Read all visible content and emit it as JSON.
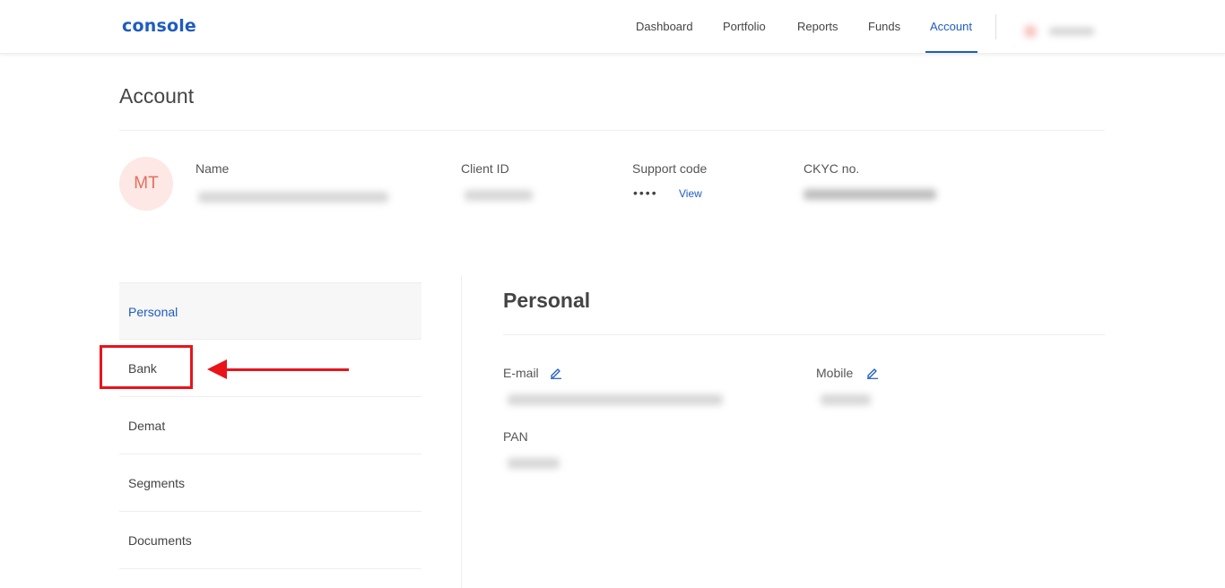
{
  "header": {
    "logo": "console",
    "nav": [
      {
        "label": "Dashboard",
        "active": false
      },
      {
        "label": "Portfolio",
        "active": false
      },
      {
        "label": "Reports",
        "active": false
      },
      {
        "label": "Funds",
        "active": false
      },
      {
        "label": "Account",
        "active": true
      }
    ]
  },
  "page": {
    "title": "Account"
  },
  "profile": {
    "initials": "MT",
    "name_label": "Name",
    "client_id_label": "Client ID",
    "support_code_label": "Support code",
    "support_code_mask": "••••",
    "support_view_label": "View",
    "ckyc_label": "CKYC no."
  },
  "sidebar": {
    "items": [
      {
        "label": "Personal",
        "active": true
      },
      {
        "label": "Bank",
        "active": false
      },
      {
        "label": "Demat",
        "active": false
      },
      {
        "label": "Segments",
        "active": false
      },
      {
        "label": "Documents",
        "active": false
      }
    ]
  },
  "personal": {
    "title": "Personal",
    "email_label": "E-mail",
    "mobile_label": "Mobile",
    "pan_label": "PAN"
  },
  "colors": {
    "accent": "#1e5cbf",
    "annotation": "#e8141a",
    "avatar_bg": "#fde8e5",
    "avatar_text": "#e3705e"
  }
}
